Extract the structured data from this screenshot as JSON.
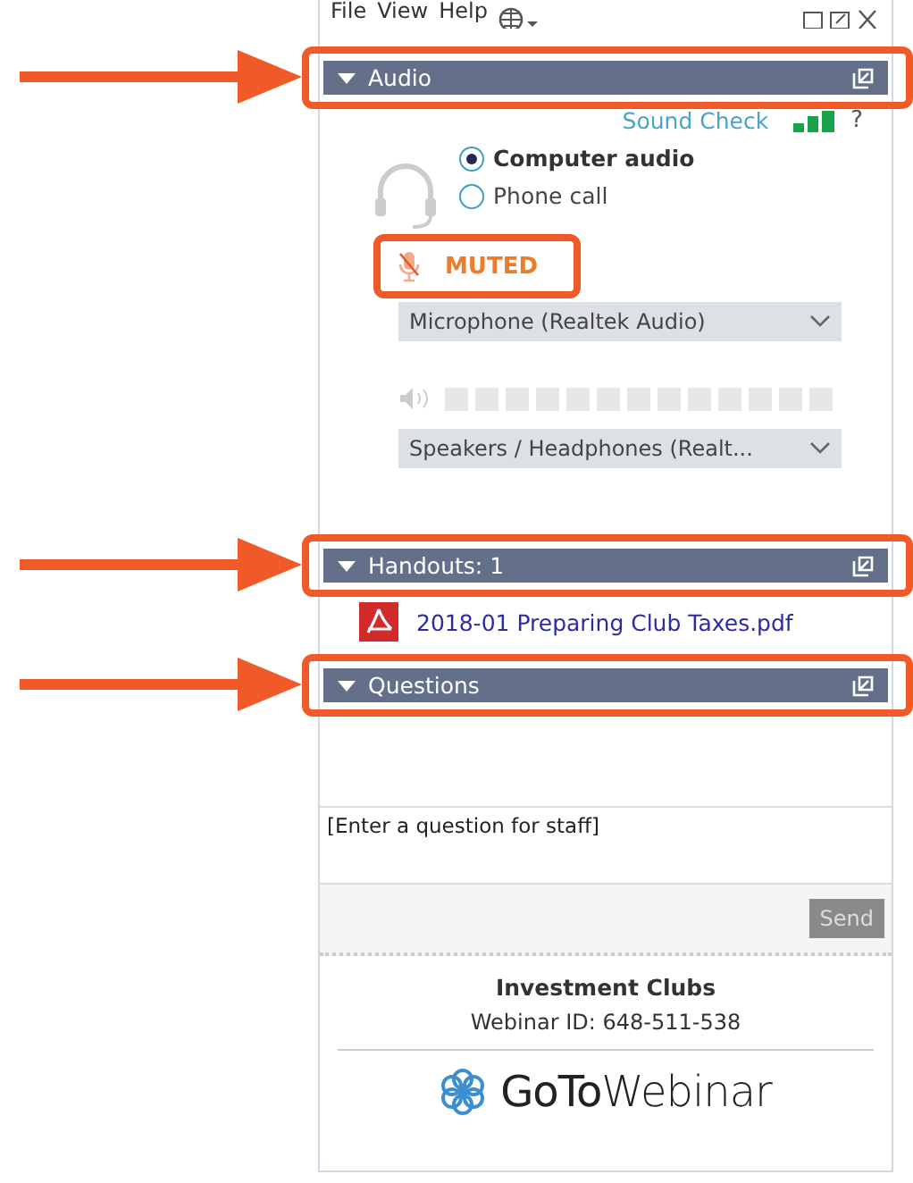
{
  "menu": [
    "File",
    "View",
    "Help"
  ],
  "audio": {
    "title": "Audio",
    "expanded": true,
    "annotated": true,
    "sound_check": "Sound Check",
    "help": "?",
    "options": [
      {
        "label": "Computer audio",
        "selected": true
      },
      {
        "label": "Phone call",
        "selected": false
      }
    ],
    "muted": {
      "label": "MUTED",
      "annotated": true
    },
    "microphone": "Microphone (Realtek Audio)",
    "speakers": "Speakers / Headphones (Realt..."
  },
  "handouts": {
    "title": "Handouts: 1",
    "expanded": true,
    "annotated": true,
    "files": [
      "2018-01 Preparing Club Taxes.pdf"
    ]
  },
  "questions": {
    "title": "Questions",
    "expanded": true,
    "annotated": true,
    "placeholder": "[Enter a question for staff]",
    "send": "Send",
    "send_disabled": true
  },
  "footer": {
    "title": "Investment Clubs",
    "webinar_id": "Webinar ID: 648-511-538",
    "logo": "**GoTo**Webinar"
  }
}
